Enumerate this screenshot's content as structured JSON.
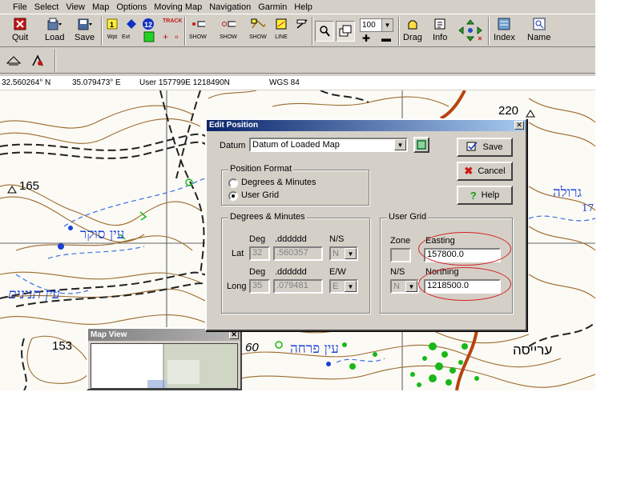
{
  "menu": [
    "File",
    "Select",
    "View",
    "Map",
    "Options",
    "Moving Map",
    "Navigation",
    "Garmin",
    "Help"
  ],
  "toolbar": {
    "quit": "Quit",
    "load": "Load",
    "save": "Save",
    "wpt": "Wpt",
    "evt": "Evt",
    "track": "TRACK",
    "show1": "SHOW",
    "show2": "SHOW",
    "show3": "SHOW",
    "line": "LINE",
    "zoom_value": "100",
    "drag": "Drag",
    "info": "Info",
    "index": "Index",
    "name": "Name"
  },
  "status": {
    "lat": "32.560264° N",
    "lon": "35.079473° E",
    "user_grid": "User  157799E  1218490N",
    "datum": "WGS 84"
  },
  "map": {
    "labels": [
      "220",
      "165",
      "153",
      "60"
    ],
    "hebrew": [
      "עין סוקר",
      "עין תנינים",
      "עין פרחה",
      "ערייסה",
      "גרולה",
      "17"
    ]
  },
  "mapview": {
    "title": "Map View"
  },
  "dialog": {
    "title": "Edit Position",
    "datum_label": "Datum",
    "datum_value": "Datum of Loaded Map",
    "save": "Save",
    "cancel": "Cancel",
    "help": "Help",
    "position_format": {
      "label": "Position  Format",
      "opt_degmin": "Degrees & Minutes",
      "opt_usergrid": "User Grid",
      "selected": "User Grid"
    },
    "degmin": {
      "label": "Degrees & Minutes",
      "deg": "Deg",
      "ddddd": ".dddddd",
      "ns": "N/S",
      "ew": "E/W",
      "lat": "Lat",
      "long": "Long",
      "lat_deg": "32",
      "lat_dec": ".560357",
      "lat_hemi": "N",
      "lon_deg": "35",
      "lon_dec": ".079481",
      "lon_hemi": "E"
    },
    "usergrid": {
      "label": "User Grid",
      "zone": "Zone",
      "easting": "Easting",
      "ns": "N/S",
      "northing": "Northing",
      "easting_value": "157800.0",
      "northing_value": "1218500.0",
      "ns_value": "N"
    }
  },
  "colors": {
    "highlight_ring": "#d42020",
    "map_blue": "#1b3fd6",
    "map_green": "#18b818",
    "road": "#b7440e"
  }
}
